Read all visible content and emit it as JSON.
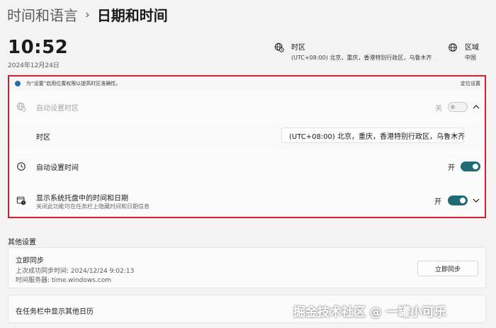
{
  "breadcrumb": {
    "parent": "时间和语言",
    "separator": "›",
    "current": "日期和时间"
  },
  "clock": {
    "time": "10:52",
    "date": "2024年12月24日"
  },
  "timezone_info": {
    "label": "时区",
    "value": "(UTC+08:00) 北京，重庆，香港特别行政区，乌鲁木齐",
    "icon": "globe-clock-icon"
  },
  "region_info": {
    "label": "区域",
    "value": "中国",
    "icon": "globe-icon"
  },
  "banner": {
    "text": "为“设置”启用位置权限以提高时区准确性。",
    "link": "定位设置"
  },
  "auto_timezone": {
    "label": "自动设置时区",
    "state": "关",
    "enabled": false
  },
  "timezone_row": {
    "label": "时区",
    "selected": "(UTC+08:00) 北京，重庆，香港特别行政区，乌鲁木齐"
  },
  "auto_time": {
    "label": "自动设置时间",
    "state": "开",
    "enabled": true
  },
  "tray": {
    "label": "显示系统托盘中的时间和日期",
    "sub": "关闭此功能可在任务栏上隐藏时间和日期信息",
    "state": "开",
    "enabled": true
  },
  "other": {
    "title": "其他设置"
  },
  "sync": {
    "title": "立即同步",
    "last": "上次成功同步时间: 2024/12/24 9:02:13",
    "server": "时间服务器: time.windows.com",
    "button": "立即同步"
  },
  "calendar": {
    "title": "在任务栏中显示其他日历"
  },
  "watermark": "掘金技术社区 @ 一罐小可乐",
  "colors": {
    "accent": "#1f6b75",
    "highlight": "#d1202f",
    "info_dot": "#1e6fa8"
  }
}
